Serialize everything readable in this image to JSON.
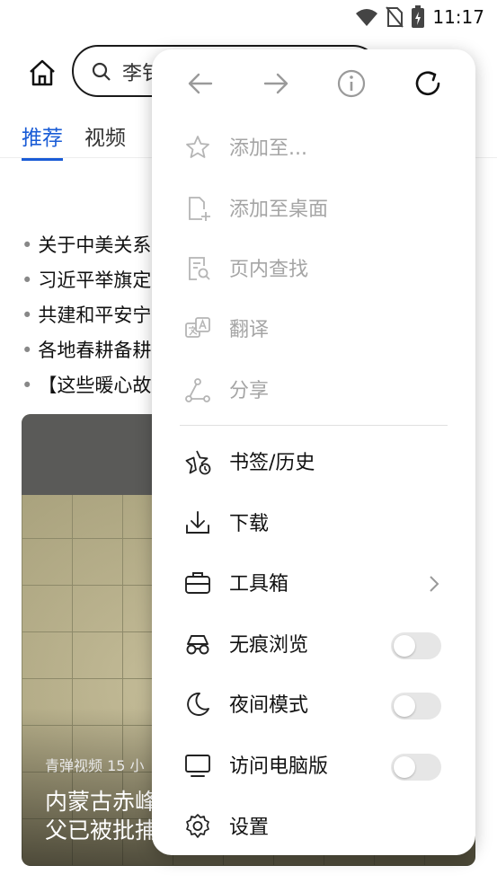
{
  "status_bar": {
    "time": "11:17",
    "icons": [
      "wifi-icon",
      "no-sim-icon",
      "battery-charging-icon"
    ]
  },
  "header": {
    "search_text": "李钅"
  },
  "tabs": [
    {
      "label": "推荐",
      "active": true
    },
    {
      "label": "视频",
      "active": false
    }
  ],
  "news": [
    "关于中美关系",
    "习近平举旗定",
    "共建和平安宁",
    "各地春耕备耕",
    "【这些暖心故"
  ],
  "feed": {
    "meta": "青弹视频  15 小",
    "title_line1": "内蒙古赤峰",
    "title_line2": "父已被批捕"
  },
  "menu": {
    "nav_icons": [
      "back-arrow-icon",
      "forward-arrow-icon",
      "info-icon",
      "refresh-icon"
    ],
    "items": [
      {
        "label": "添加至...",
        "icon": "star-outline-icon",
        "enabled": false
      },
      {
        "label": "添加至桌面",
        "icon": "add-to-desktop-icon",
        "enabled": false
      },
      {
        "label": "页内查找",
        "icon": "find-in-page-icon",
        "enabled": false
      },
      {
        "label": "翻译",
        "icon": "translate-icon",
        "enabled": false
      },
      {
        "label": "分享",
        "icon": "share-icon",
        "enabled": false
      },
      {
        "label": "书签/历史",
        "icon": "bookmark-history-icon",
        "enabled": true
      },
      {
        "label": "下载",
        "icon": "download-icon",
        "enabled": true
      },
      {
        "label": "工具箱",
        "icon": "toolbox-icon",
        "enabled": true,
        "has_submenu": true
      },
      {
        "label": "无痕浏览",
        "icon": "incognito-icon",
        "enabled": true,
        "toggle": false
      },
      {
        "label": "夜间模式",
        "icon": "moon-icon",
        "enabled": true,
        "toggle": false
      },
      {
        "label": "访问电脑版",
        "icon": "desktop-monitor-icon",
        "enabled": true,
        "toggle": false
      },
      {
        "label": "设置",
        "icon": "settings-gear-icon",
        "enabled": true
      }
    ]
  }
}
